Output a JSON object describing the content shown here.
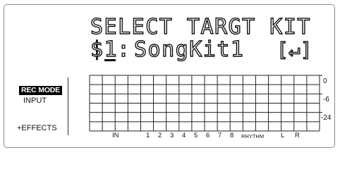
{
  "display": {
    "title": "SELECT TARGT KIT",
    "kit_slot": "$1",
    "kit_separator": ":",
    "kit_name": "SongKit1",
    "enter_symbol": "[↵]"
  },
  "side_menu": {
    "rec_mode": "REC MODE",
    "input": "INPUT",
    "effects": "+EFFECTS"
  },
  "meter": {
    "db_scale": [
      "0",
      "-6",
      "-24"
    ],
    "channels": [
      "IN",
      "1",
      "2",
      "3",
      "4",
      "5",
      "6",
      "7",
      "8",
      "RHYTHM",
      "L",
      "R"
    ]
  }
}
